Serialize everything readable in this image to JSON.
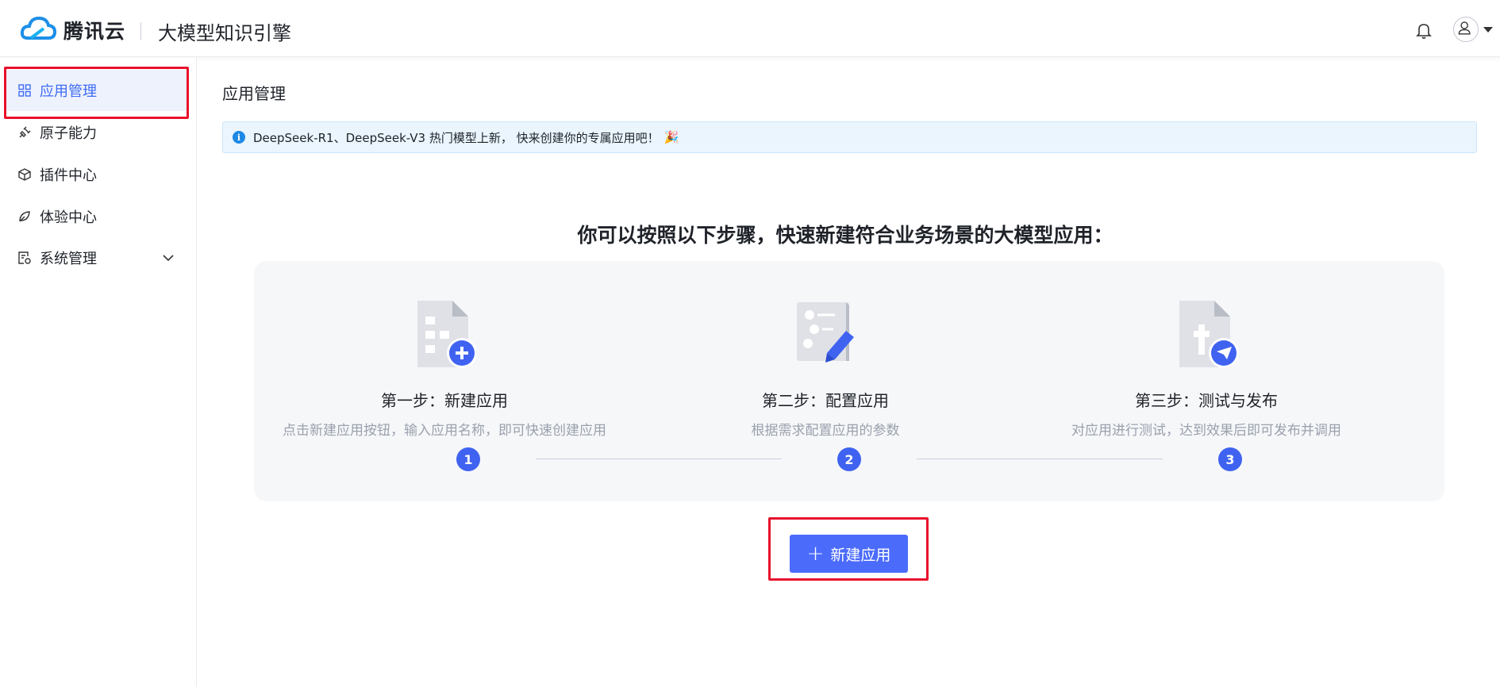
{
  "header": {
    "brand": "腾讯云",
    "product": "大模型知识引擎",
    "icons": [
      "tencent-cloud-logo",
      "bell-icon",
      "user-icon",
      "caret-down-icon"
    ]
  },
  "sidebar": {
    "items": [
      {
        "label": "应用管理",
        "icon": "grid-icon",
        "active": true
      },
      {
        "label": "原子能力",
        "icon": "plug-icon",
        "active": false
      },
      {
        "label": "插件中心",
        "icon": "cube-icon",
        "active": false
      },
      {
        "label": "体验中心",
        "icon": "leaf-icon",
        "active": false
      },
      {
        "label": "系统管理",
        "icon": "settings-doc-icon",
        "active": false,
        "expandable": true
      }
    ]
  },
  "main": {
    "page_title": "应用管理",
    "notice": {
      "text": "DeepSeek-R1、DeepSeek-V3 热门模型上新， 快来创建你的专属应用吧！",
      "emoji": "🎉"
    },
    "headline": "你可以按照以下步骤，快速新建符合业务场景的大模型应用：",
    "steps": [
      {
        "number": "1",
        "title": "第一步：新建应用",
        "desc": "点击新建应用按钮，输入应用名称，即可快速创建应用"
      },
      {
        "number": "2",
        "title": "第二步：配置应用",
        "desc": "根据需求配置应用的参数"
      },
      {
        "number": "3",
        "title": "第三步：测试与发布",
        "desc": "对应用进行测试，达到效果后即可发布并调用"
      }
    ],
    "create_button": {
      "plus": "+",
      "label": "新建应用"
    }
  },
  "colors": {
    "accent": "#4b6bfb",
    "highlight": "#e8112b",
    "notice_bg": "#eaf5fe"
  }
}
